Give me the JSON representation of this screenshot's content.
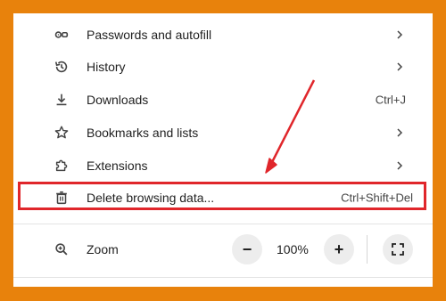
{
  "menu": {
    "items": [
      {
        "label": "Passwords and autofill",
        "icon": "key-icon",
        "shortcut": "",
        "submenu": true
      },
      {
        "label": "History",
        "icon": "history-icon",
        "shortcut": "",
        "submenu": true
      },
      {
        "label": "Downloads",
        "icon": "download-icon",
        "shortcut": "Ctrl+J",
        "submenu": false
      },
      {
        "label": "Bookmarks and lists",
        "icon": "star-icon",
        "shortcut": "",
        "submenu": true
      },
      {
        "label": "Extensions",
        "icon": "puzzle-icon",
        "shortcut": "",
        "submenu": true
      },
      {
        "label": "Delete browsing data...",
        "icon": "trash-icon",
        "shortcut": "Ctrl+Shift+Del",
        "submenu": false
      }
    ],
    "zoom": {
      "label": "Zoom",
      "value": "100%",
      "minus": "−",
      "plus": "+"
    }
  },
  "annotation": {
    "highlight_color": "#e0262b",
    "frame_color": "#e8820c"
  }
}
